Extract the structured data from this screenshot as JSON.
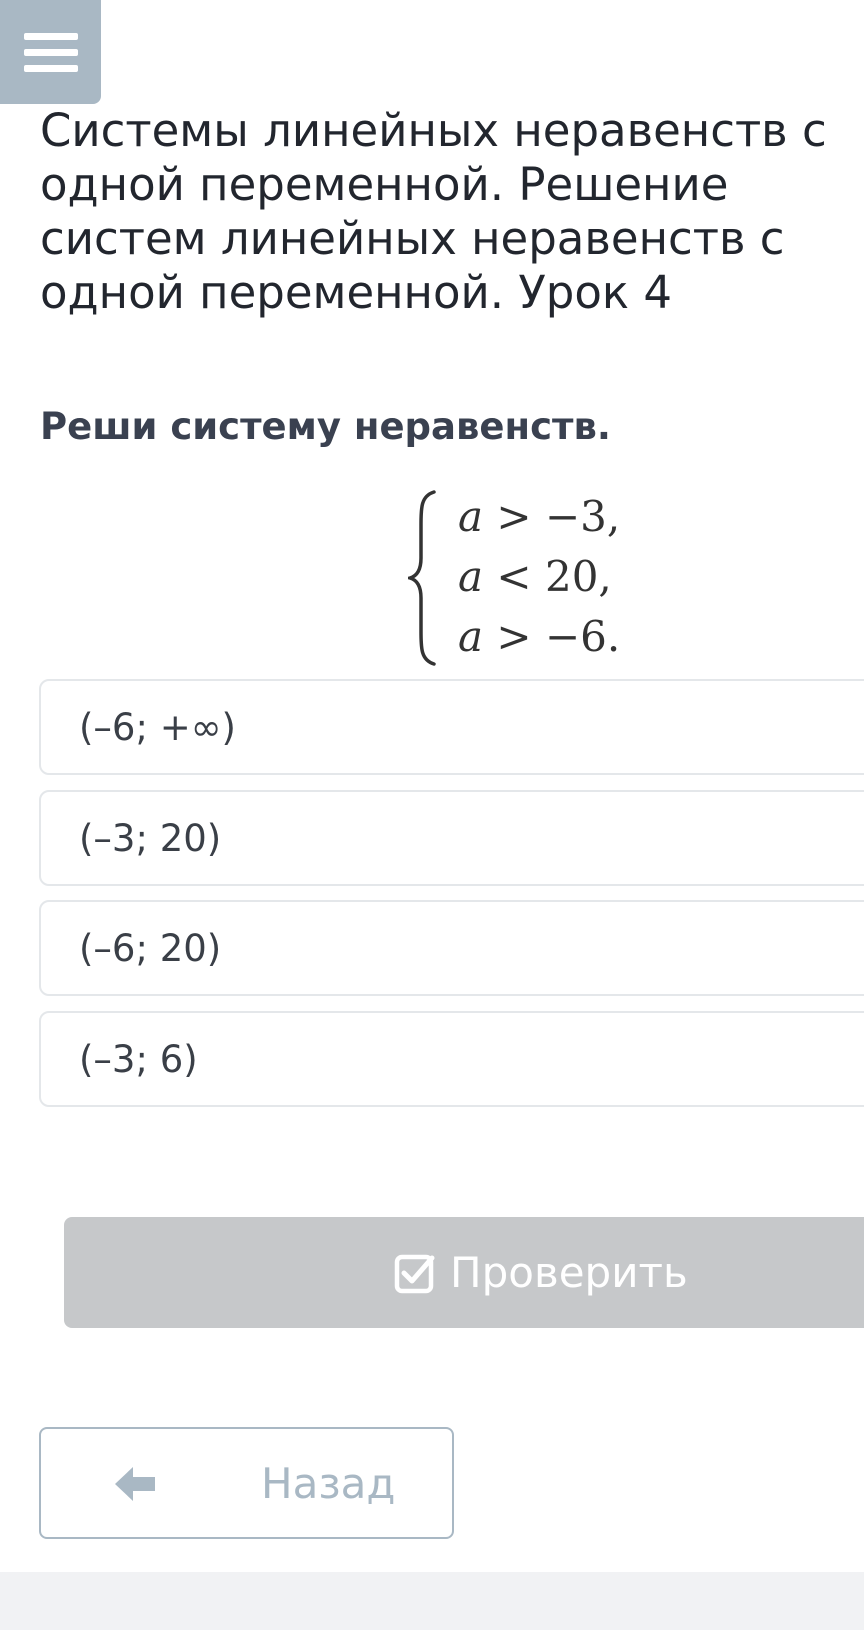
{
  "header": {
    "menu_icon": "hamburger-menu-icon",
    "menu_color": "#a9b8c4"
  },
  "lesson": {
    "title": "Системы линейных неравенств с одной переменной. Решение систем линейных неравенств с одной переменной. Урок 4"
  },
  "task": {
    "prompt": "Реши систему неравенств.",
    "system": [
      {
        "var": "a",
        "sign": ">",
        "value": "−3,"
      },
      {
        "var": "a",
        "sign": "<",
        "value": "20,"
      },
      {
        "var": "a",
        "sign": ">",
        "value": "−6."
      }
    ]
  },
  "options": [
    "(–6; +∞)",
    "(–3; 20)",
    "(–6; 20)",
    "(–3; 6)"
  ],
  "actions": {
    "check_label": "Проверить",
    "check_icon": "checkbox-check-icon",
    "back_label": "Назад",
    "back_icon": "arrow-left-icon",
    "check_bg": "#c6c8ca"
  }
}
